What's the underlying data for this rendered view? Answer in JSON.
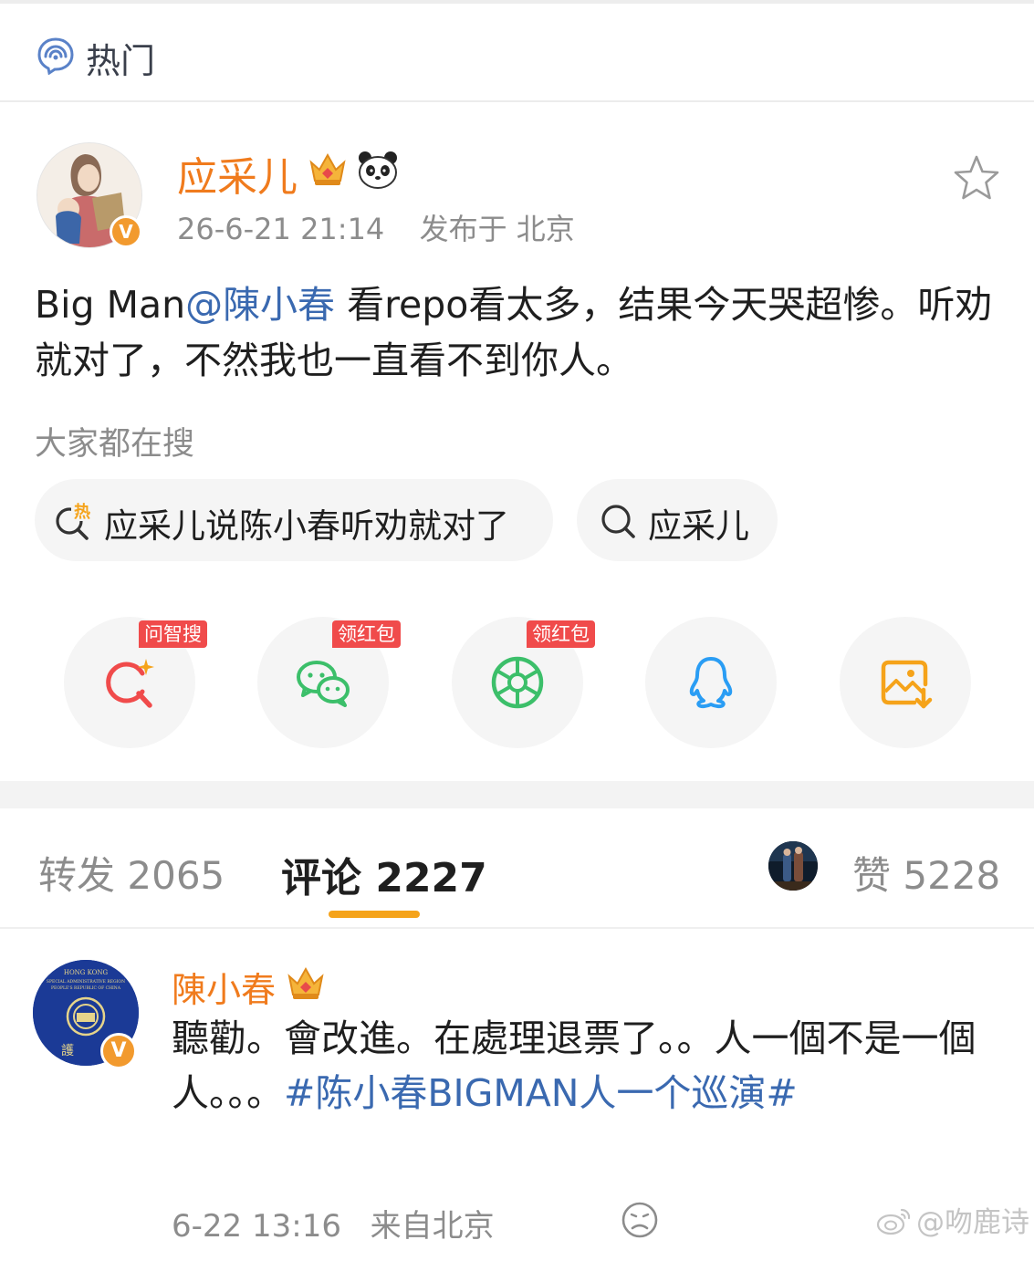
{
  "header": {
    "title": "热门",
    "icon": "hot-trend-icon"
  },
  "post": {
    "author": {
      "name": "应采儿",
      "badges": [
        "crown-icon",
        "panda-icon"
      ],
      "verified_mark": "V"
    },
    "timestamp": "26-6-21 21:14",
    "location": "发布于 北京",
    "text_prefix": "Big Man",
    "mention": "@陳小春",
    "text_suffix": " 看repo看太多，结果今天哭超惨。听劝就对了，不然我也一直看不到你人。",
    "favorite_icon": "star-outline-icon"
  },
  "search": {
    "hint": "大家都在搜",
    "chips": [
      {
        "icon": "hot-search-icon",
        "hot_badge": "热",
        "label": "应采儿说陈小春听劝就对了"
      },
      {
        "icon": "search-icon",
        "label": "应采儿"
      }
    ]
  },
  "share": {
    "buttons": [
      {
        "icon": "smart-search-icon",
        "tag": "问智搜",
        "color": "#f04b4b"
      },
      {
        "icon": "wechat-icon",
        "tag": "领红包",
        "color": "#3cbf6a"
      },
      {
        "icon": "moments-shutter-icon",
        "tag": "领红包",
        "color": "#3cbf6a"
      },
      {
        "icon": "qq-penguin-icon",
        "tag": "",
        "color": "#2a9df4"
      },
      {
        "icon": "save-image-icon",
        "tag": "",
        "color": "#f5a31a"
      }
    ]
  },
  "tabs": {
    "repost_label": "转发",
    "repost_count": "2065",
    "comment_label": "评论",
    "comment_count": "2227",
    "like_label": "赞",
    "like_count": "5228",
    "accent": "#f5a31a"
  },
  "comment": {
    "author": {
      "name": "陳小春",
      "badge": "crown-icon",
      "verified_mark": "V"
    },
    "text": "聽勸。會改進。在處理退票了。。人一個不是一個人。。。",
    "hashtag": "#陈小春BIGMAN人一个巡演#",
    "timestamp": "6-22 13:16",
    "location": "来自北京",
    "reaction_icon": "sad-face-icon"
  },
  "watermark": "@吻鹿诗",
  "colors": {
    "orange_name": "#f07b1d",
    "link_blue": "#3a69b0",
    "gray_text": "#8c8c8c"
  }
}
